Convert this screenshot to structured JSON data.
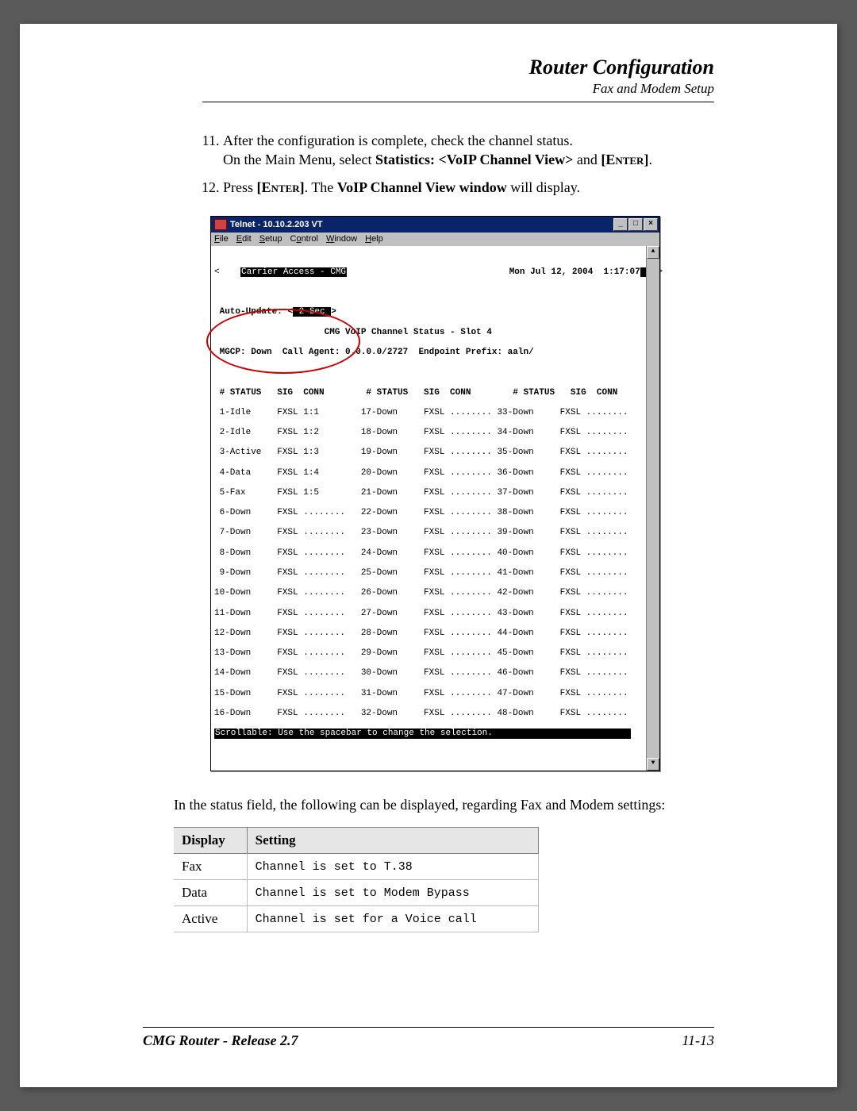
{
  "header": {
    "title": "Router Configuration",
    "subtitle": "Fax and Modem Setup"
  },
  "steps": {
    "start": 11,
    "items": [
      {
        "text_a": "After the configuration is complete, check the channel status.",
        "text_b1": "On the Main Menu, select ",
        "text_b2": "Statistics: <VoIP Channel View>",
        "text_b3": " and ",
        "text_b4": "[Enter]",
        "text_b5": "."
      },
      {
        "text_a1": "Press ",
        "text_a2": "[Enter]",
        "text_a3": ". The ",
        "text_a4": "VoIP Channel View window",
        "text_a5": " will display."
      }
    ]
  },
  "telnet": {
    "title": "Telnet - 10.10.2.203 VT",
    "minimize": "_",
    "maximize": "□",
    "close": "×",
    "menus": [
      "File",
      "Edit",
      "Setup",
      "Control",
      "Window",
      "Help"
    ],
    "banner_left_lt": "<",
    "banner_title": "Carrier Access - CMG",
    "banner_date": "Mon Jul 12, 2004  1:17:07",
    "banner_right_gt": ">",
    "scroll_up": "▲",
    "scroll_down": "▼",
    "auto_update_label": "Auto-Update: <",
    "auto_update_val": " 2 Sec ",
    "auto_update_end": ">",
    "status_header": "                     CMG VoIP Channel Status - Slot 4",
    "mgcp_line": "MGCP: Down  Call Agent: 0.0.0.0/2727  Endpoint Prefix: aaln/",
    "col_header": " # STATUS   SIG  CONN        # STATUS   SIG  CONN        # STATUS   SIG  CONN",
    "rows": [
      " 1-Idle     FXSL 1:1        17-Down     FXSL ........ 33-Down     FXSL ........",
      " 2-Idle     FXSL 1:2        18-Down     FXSL ........ 34-Down     FXSL ........",
      " 3-Active   FXSL 1:3        19-Down     FXSL ........ 35-Down     FXSL ........",
      " 4-Data     FXSL 1:4        20-Down     FXSL ........ 36-Down     FXSL ........",
      " 5-Fax      FXSL 1:5        21-Down     FXSL ........ 37-Down     FXSL ........",
      " 6-Down     FXSL ........   22-Down     FXSL ........ 38-Down     FXSL ........",
      " 7-Down     FXSL ........   23-Down     FXSL ........ 39-Down     FXSL ........",
      " 8-Down     FXSL ........   24-Down     FXSL ........ 40-Down     FXSL ........",
      " 9-Down     FXSL ........   25-Down     FXSL ........ 41-Down     FXSL ........",
      "10-Down     FXSL ........   26-Down     FXSL ........ 42-Down     FXSL ........",
      "11-Down     FXSL ........   27-Down     FXSL ........ 43-Down     FXSL ........",
      "12-Down     FXSL ........   28-Down     FXSL ........ 44-Down     FXSL ........",
      "13-Down     FXSL ........   29-Down     FXSL ........ 45-Down     FXSL ........",
      "14-Down     FXSL ........   30-Down     FXSL ........ 46-Down     FXSL ........",
      "15-Down     FXSL ........   31-Down     FXSL ........ 47-Down     FXSL ........",
      "16-Down     FXSL ........   32-Down     FXSL ........ 48-Down     FXSL ........"
    ],
    "footer_line": "Scrollable: Use the spacebar to change the selection."
  },
  "paragraph": "In the status field, the following can be displayed, regarding Fax and Modem settings:",
  "table": {
    "headers": [
      "Display",
      "Setting"
    ],
    "rows": [
      [
        "Fax",
        "Channel is set to T.38"
      ],
      [
        "Data",
        "Channel is set to Modem Bypass"
      ],
      [
        "Active",
        "Channel is set for a Voice call"
      ]
    ]
  },
  "footer": {
    "left": "CMG Router - Release 2.7",
    "right": "11-13"
  }
}
